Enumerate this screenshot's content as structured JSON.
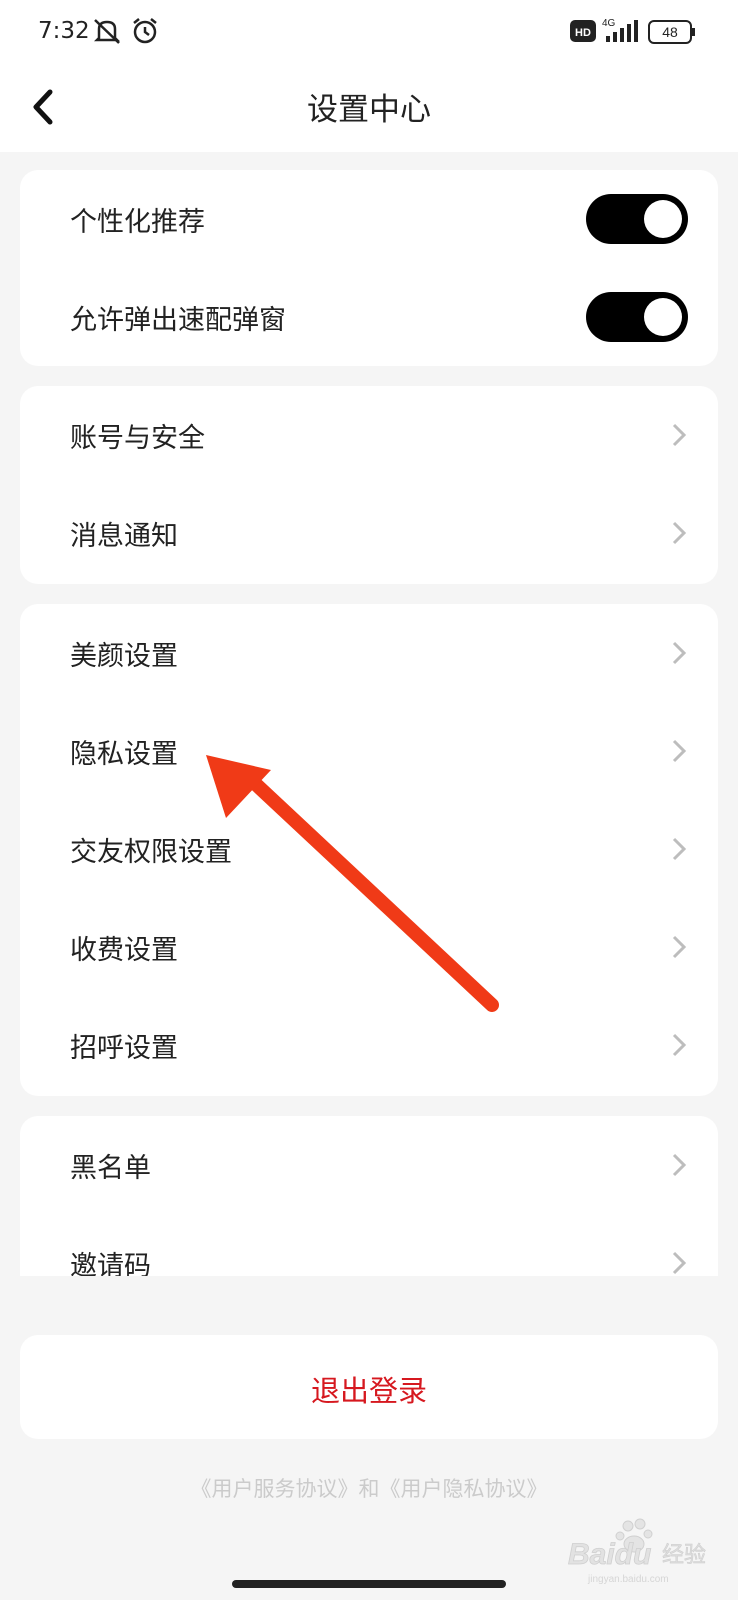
{
  "status_bar": {
    "time": "7:32",
    "battery": "48",
    "network": "4G",
    "hd": "HD"
  },
  "header": {
    "title": "设置中心"
  },
  "group1": [
    {
      "label": "个性化推荐",
      "toggle": "on"
    },
    {
      "label": "允许弹出速配弹窗",
      "toggle": "on"
    }
  ],
  "group2": [
    {
      "label": "账号与安全"
    },
    {
      "label": "消息通知"
    }
  ],
  "group3": [
    {
      "label": "美颜设置"
    },
    {
      "label": "隐私设置"
    },
    {
      "label": "交友权限设置"
    },
    {
      "label": "收费设置"
    },
    {
      "label": "招呼设置"
    }
  ],
  "group4": [
    {
      "label": "黑名单"
    },
    {
      "label": "邀请码"
    }
  ],
  "logout_label": "退出登录",
  "footer_text": "《用户服务协议》和《用户隐私协议》",
  "watermark": {
    "brand": "Baidu",
    "suffix": "经验",
    "sub": "jingyan.baidu.com"
  },
  "colors": {
    "accent": "#d6181f",
    "annotation_arrow": "#f03a17",
    "toggle_on": "#000000"
  }
}
